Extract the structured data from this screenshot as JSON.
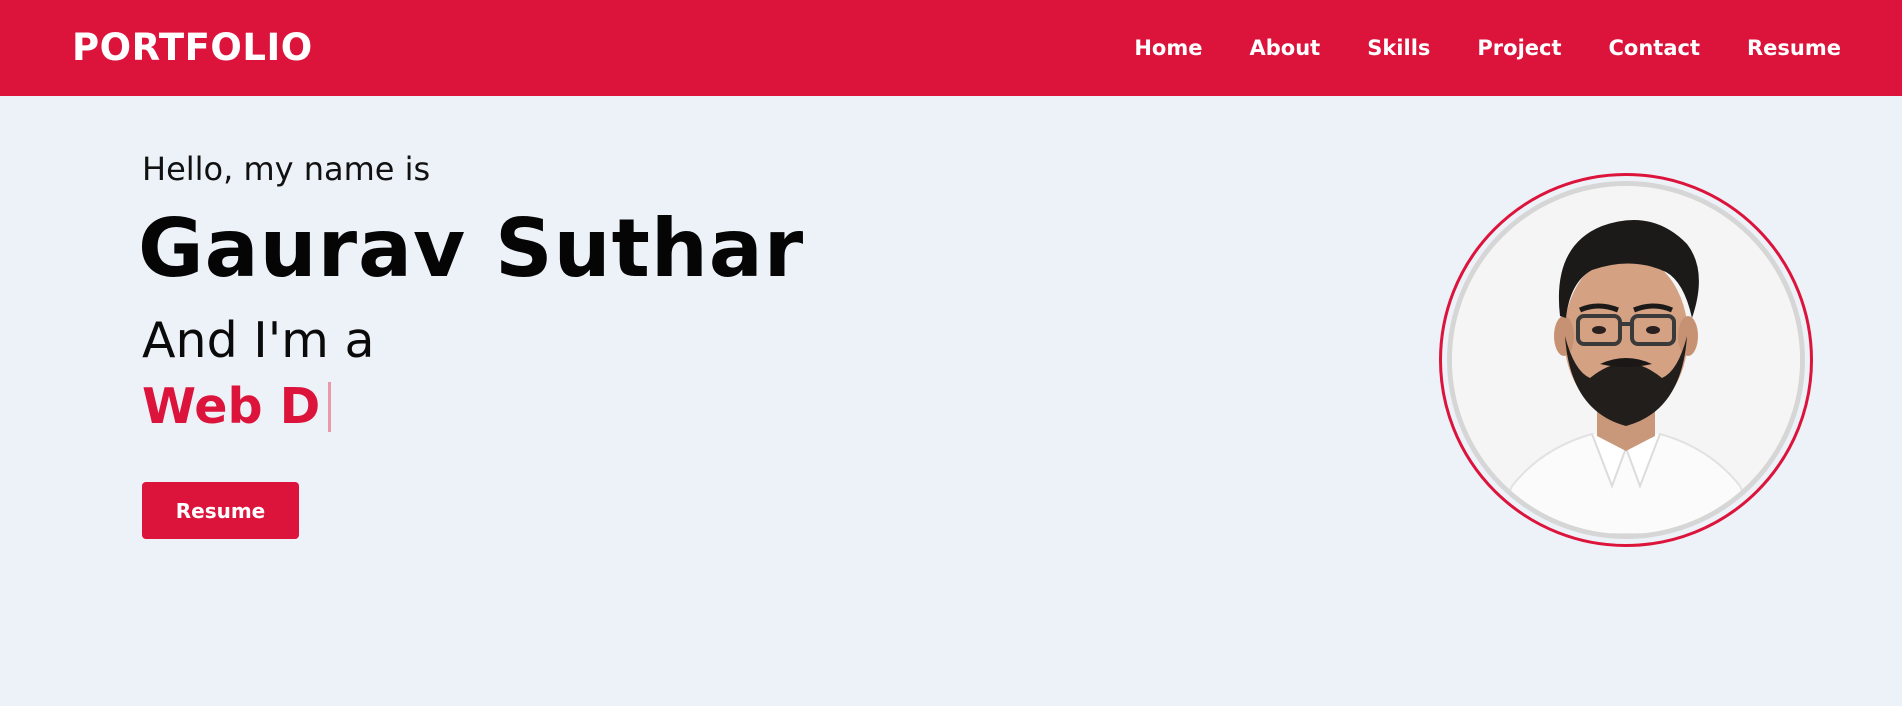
{
  "navbar": {
    "brand": "PORTFOLIO",
    "links": [
      {
        "label": "Home"
      },
      {
        "label": "About"
      },
      {
        "label": "Skills"
      },
      {
        "label": "Project"
      },
      {
        "label": "Contact"
      },
      {
        "label": "Resume"
      }
    ]
  },
  "hero": {
    "greeting": "Hello, my name is",
    "name": "Gaurav Suthar",
    "intro": "And I'm a",
    "typed_role": "Web D",
    "resume_button": "Resume"
  },
  "profile_photo": {
    "description_icon": "person-portrait"
  },
  "colors": {
    "accent": "#dc143c",
    "background": "#edf1f8",
    "text": "#111111"
  }
}
